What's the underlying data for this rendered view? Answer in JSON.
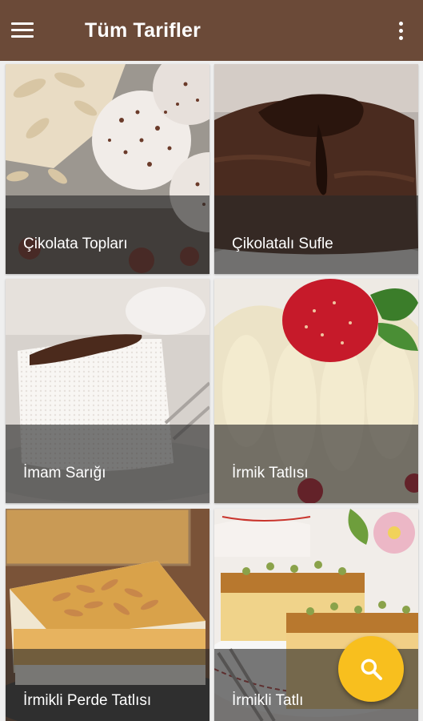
{
  "appbar": {
    "title": "Tüm Tarifler",
    "menu_icon": "hamburger-menu-icon",
    "overflow_icon": "more-vert-icon",
    "background": "#6b4a38"
  },
  "recipes": [
    {
      "name": "Çikolata Topları"
    },
    {
      "name": "Çikolatalı Sufle"
    },
    {
      "name": "İmam Sarığı"
    },
    {
      "name": "İrmik Tatlısı"
    },
    {
      "name": "İrmikli Perde Tatlısı"
    },
    {
      "name": "İrmikli Tatlı"
    }
  ],
  "fab": {
    "icon": "search-icon",
    "color": "#f8bf1e"
  }
}
